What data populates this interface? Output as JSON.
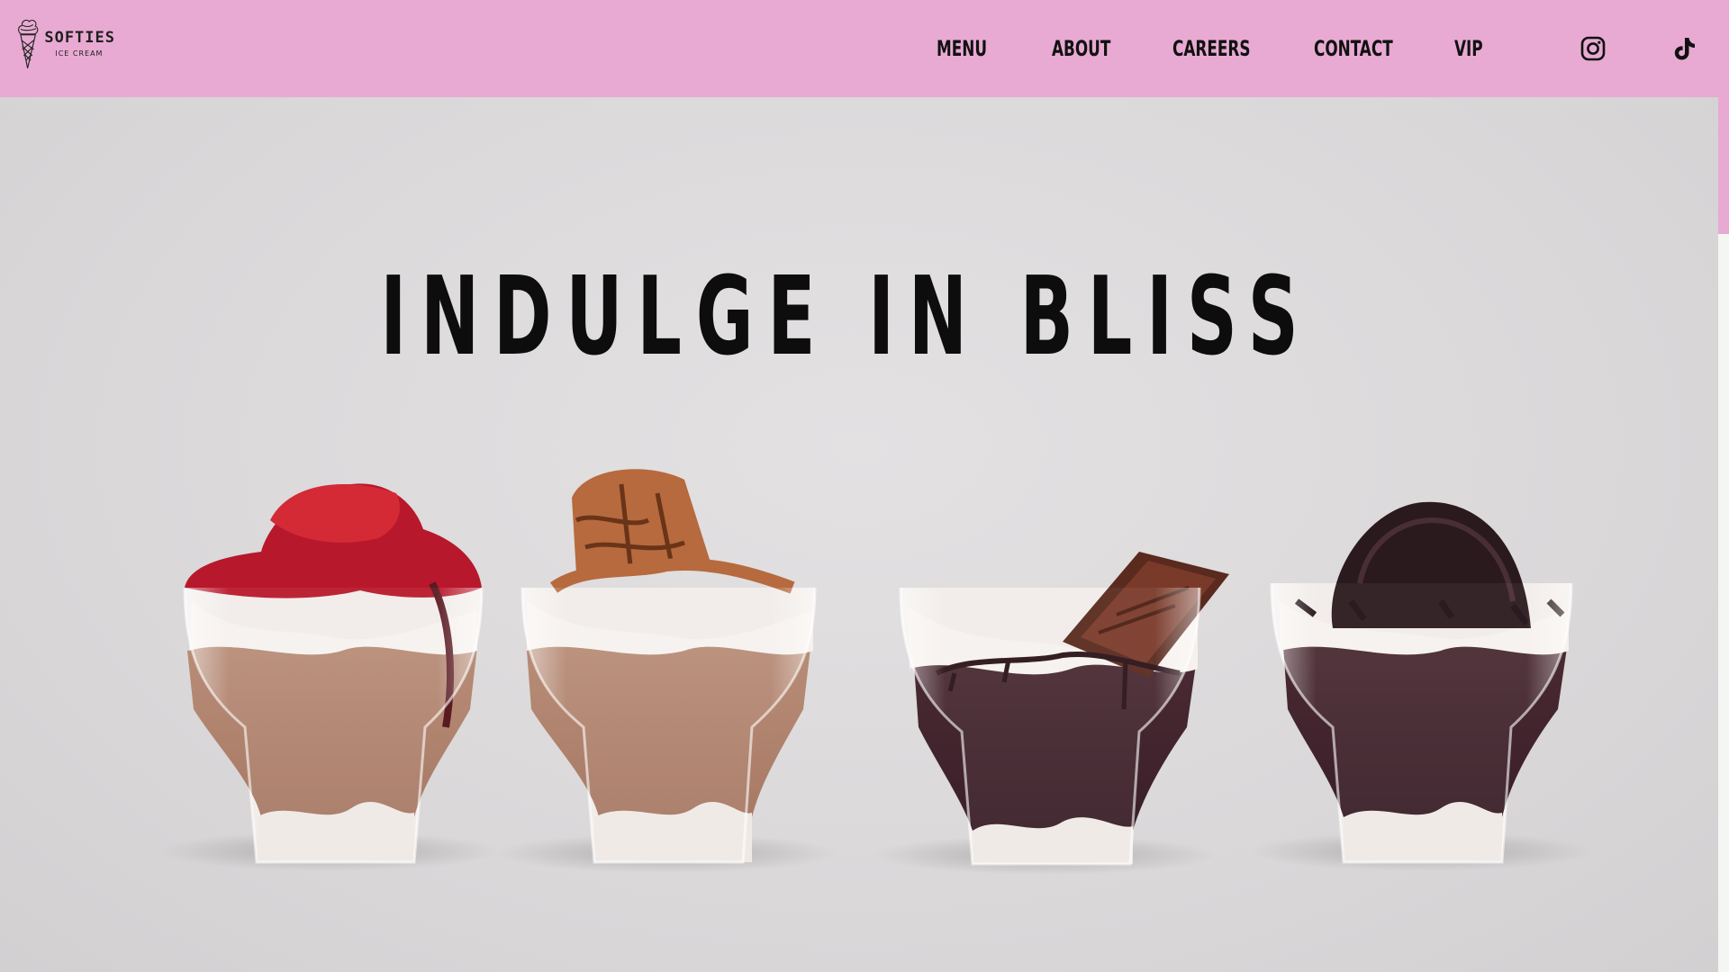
{
  "brand": {
    "name": "SOFTIES",
    "tagline": "ICE CREAM"
  },
  "nav": {
    "items": [
      {
        "label": "MENU"
      },
      {
        "label": "ABOUT"
      },
      {
        "label": "CAREERS"
      },
      {
        "label": "CONTACT"
      },
      {
        "label": "VIP"
      }
    ]
  },
  "social": {
    "icons": [
      "instagram-icon",
      "tiktok-icon"
    ]
  },
  "hero": {
    "title": "INDULGE IN BLISS",
    "image": "four layered dessert cups with strawberry, biscoff cookie, chocolate bar and oreo toppings"
  },
  "colors": {
    "header_bg": "#e8aad2",
    "hero_bg": "#dcdadb",
    "text": "#111111"
  }
}
